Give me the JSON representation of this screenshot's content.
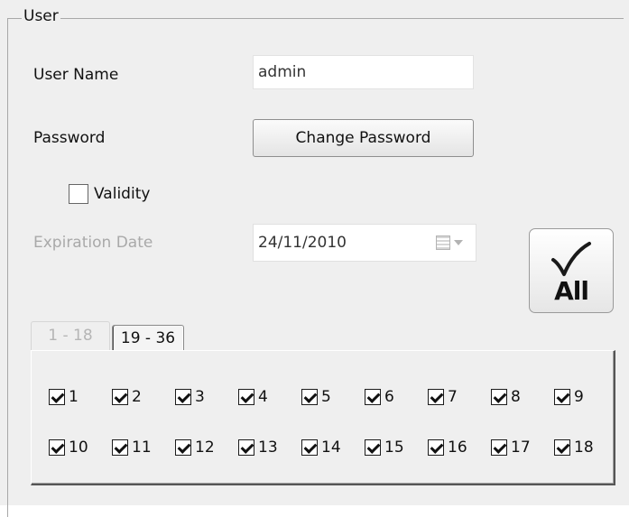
{
  "group": {
    "title": "User"
  },
  "username": {
    "label": "User Name",
    "value": "admin"
  },
  "password": {
    "label": "Password",
    "button_label": "Change Password"
  },
  "validity": {
    "label": "Validity",
    "checked": false
  },
  "expiration": {
    "label": "Expiration Date",
    "value": "24/11/2010"
  },
  "all_button": {
    "label": "All"
  },
  "tabs": [
    {
      "label": "1 - 18",
      "active": true
    },
    {
      "label": "19 - 36",
      "active": false
    }
  ],
  "channels": [
    {
      "label": "1",
      "checked": true
    },
    {
      "label": "2",
      "checked": true
    },
    {
      "label": "3",
      "checked": true
    },
    {
      "label": "4",
      "checked": true
    },
    {
      "label": "5",
      "checked": true
    },
    {
      "label": "6",
      "checked": true
    },
    {
      "label": "7",
      "checked": true
    },
    {
      "label": "8",
      "checked": true
    },
    {
      "label": "9",
      "checked": true
    },
    {
      "label": "10",
      "checked": true
    },
    {
      "label": "11",
      "checked": true
    },
    {
      "label": "12",
      "checked": true
    },
    {
      "label": "13",
      "checked": true
    },
    {
      "label": "14",
      "checked": true
    },
    {
      "label": "15",
      "checked": true
    },
    {
      "label": "16",
      "checked": true
    },
    {
      "label": "17",
      "checked": true
    },
    {
      "label": "18",
      "checked": true
    }
  ]
}
